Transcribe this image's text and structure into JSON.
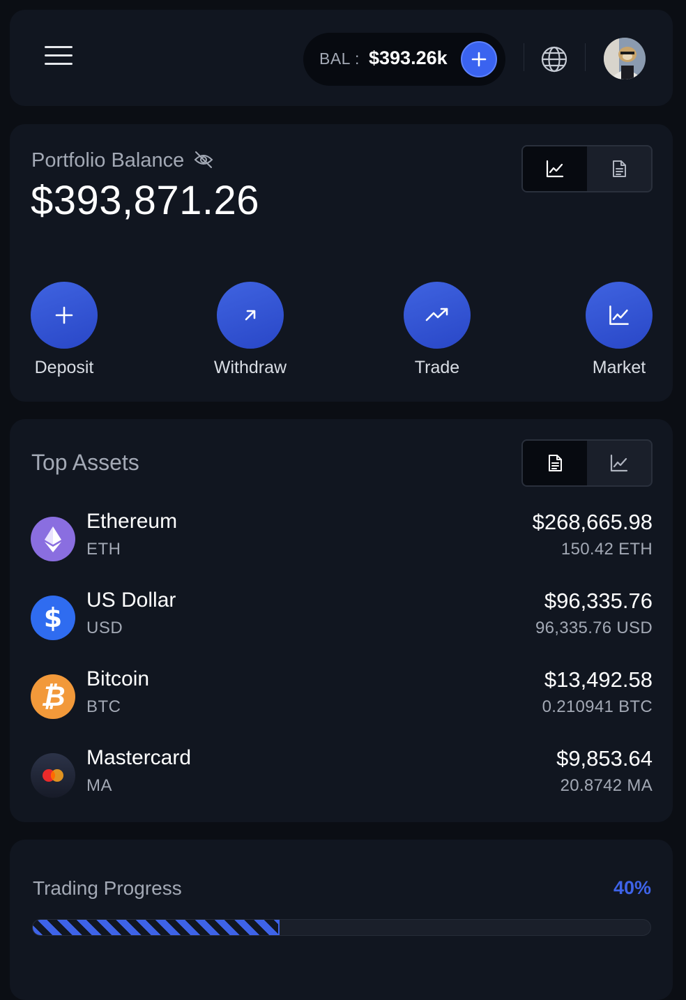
{
  "header": {
    "balance_label": "BAL :",
    "balance_value": "$393.26k"
  },
  "portfolio": {
    "label": "Portfolio Balance",
    "value": "$393,871.26",
    "view_toggle": {
      "active": "chart",
      "options": [
        "chart",
        "document"
      ]
    },
    "actions": [
      {
        "label": "Deposit",
        "icon": "plus-icon"
      },
      {
        "label": "Withdraw",
        "icon": "arrow-up-right-icon"
      },
      {
        "label": "Trade",
        "icon": "trending-up-icon"
      },
      {
        "label": "Market",
        "icon": "line-chart-icon"
      }
    ]
  },
  "assets": {
    "title": "Top Assets",
    "view_toggle": {
      "active": "document",
      "options": [
        "document",
        "chart"
      ]
    },
    "items": [
      {
        "name": "Ethereum",
        "symbol": "ETH",
        "value": "$268,665.98",
        "amount": "150.42 ETH",
        "icon": "ethereum-icon",
        "color": "#8a6ee0"
      },
      {
        "name": "US Dollar",
        "symbol": "USD",
        "value": "$96,335.76",
        "amount": "96,335.76 USD",
        "icon": "dollar-icon",
        "color": "#2f6cf0"
      },
      {
        "name": "Bitcoin",
        "symbol": "BTC",
        "value": "$13,492.58",
        "amount": "0.210941 BTC",
        "icon": "bitcoin-icon",
        "color": "#f2993a"
      },
      {
        "name": "Mastercard",
        "symbol": "MA",
        "value": "$9,853.64",
        "amount": "20.8742 MA",
        "icon": "mastercard-icon",
        "color": "#22283a"
      }
    ]
  },
  "progress": {
    "title": "Trading Progress",
    "percent_label": "40%",
    "fraction": 0.4,
    "accent": "#3e63e8"
  }
}
